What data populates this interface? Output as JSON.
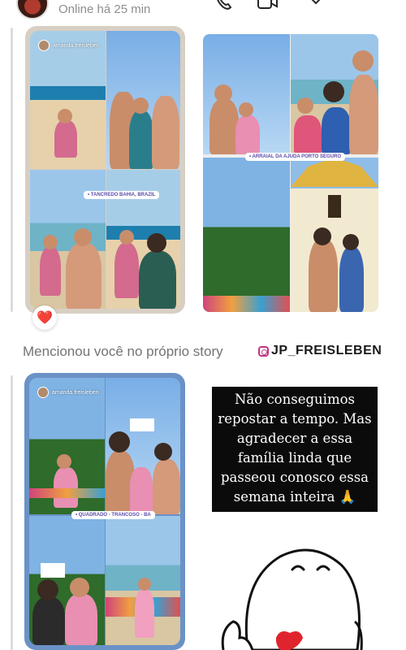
{
  "header": {
    "status": "Online há 25 min"
  },
  "story1": {
    "username": "amanda.freisleben",
    "location_tag": "• TANCREDO BAHIA, BRAZIL",
    "reaction": "❤️"
  },
  "photo": {
    "location_tag": "• ARRAIAL DA AJUDA PORTO SEGURO"
  },
  "mention": {
    "text": "Mencionou você no próprio story",
    "username": "JP_FREISLEBEN"
  },
  "story2": {
    "username": "amanda.freisleben",
    "location_tag": "• QUADRADO - TRANCOSO - BA"
  },
  "caption": {
    "text": "Não conseguimos repostar a tempo. Mas agradecer a essa família linda que passeou conosco essa semana inteira 🙏"
  },
  "colors": {
    "mention_gray": "#737373",
    "heart_red": "#e0245e",
    "story2_border": "#6a92c7"
  }
}
